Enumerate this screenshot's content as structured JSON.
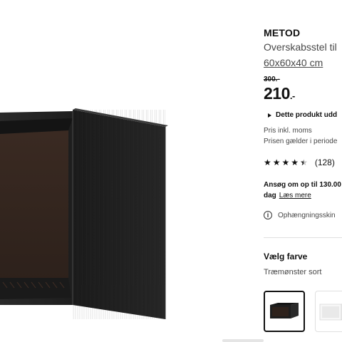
{
  "product": {
    "name": "METOD",
    "description": "Overskabsstel til",
    "dimensions": "60x60x40 cm",
    "old_price": "300.-",
    "price_main": "210",
    "price_tail": ".-",
    "info_toggle": "Dette produkt udd",
    "vat_note": "Pris inkl. moms",
    "period_note": "Prisen gælder i periode",
    "rating": {
      "value": 4.5,
      "max": 5,
      "count": "(128)"
    },
    "credit": {
      "line1": "Ansøg om op til 130.00",
      "line2": "dag",
      "link": "Læs mere"
    },
    "notice": "Ophængningsskin"
  },
  "color": {
    "title": "Vælg farve",
    "value": "Træmønster sort",
    "swatches": [
      {
        "name": "Træmønster sort",
        "color": "#1c1c1c",
        "selected": true
      },
      {
        "name": "Hvid",
        "color": "#f2f2f2",
        "selected": false
      }
    ]
  },
  "icons": {
    "toggle": "triangle-right-icon",
    "info": "info-circle-icon",
    "star": "star-icon"
  }
}
